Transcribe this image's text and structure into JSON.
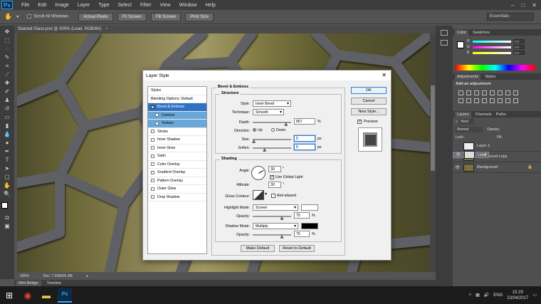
{
  "app": {
    "logo": "Ps"
  },
  "menu": [
    "File",
    "Edit",
    "Image",
    "Layer",
    "Type",
    "Select",
    "Filter",
    "View",
    "Window",
    "Help"
  ],
  "window_controls": [
    "–",
    "□",
    "✕"
  ],
  "options_bar": {
    "scroll_all": "Scroll All Windows",
    "buttons": [
      "Actual Pixels",
      "Fit Screen",
      "Fill Screen",
      "Print Size"
    ],
    "workspace": "Essentials"
  },
  "document": {
    "tab_title": "Stained Glass.psd @ 300% (Lead, RGB/8#)",
    "close": "×"
  },
  "status": {
    "zoom": "300%",
    "doc_info": "Doc: 7.03M/26.3M",
    "arrow": "▸"
  },
  "bottom_tabs": [
    "Mini Bridge",
    "Timeline"
  ],
  "color_panel": {
    "tabs": [
      "Color",
      "Swatches"
    ],
    "channels": [
      {
        "label": "R",
        "value": "255"
      },
      {
        "label": "G",
        "value": "255"
      },
      {
        "label": "B",
        "value": "255"
      }
    ]
  },
  "adjustments_panel": {
    "tabs": [
      "Adjustments",
      "Styles"
    ],
    "heading": "Add an adjustment"
  },
  "layers_panel": {
    "tabs": [
      "Layers",
      "Channels",
      "Paths"
    ],
    "kind": "Kind",
    "blend": "Normal",
    "opacity_label": "Opacity:",
    "fill_label": "Fill:",
    "lock_label": "Lock:",
    "layers": [
      {
        "name": "Layer 1",
        "visible": false,
        "selected": false
      },
      {
        "name": "Lead",
        "visible": true,
        "selected": true
      },
      {
        "name": "Background copy",
        "visible": true,
        "selected": false
      },
      {
        "name": "Background",
        "visible": true,
        "selected": false
      }
    ]
  },
  "taskbar": {
    "lang": "ENG",
    "time": "15:29",
    "date": "23/04/2017"
  },
  "dialog": {
    "title": "Layer Style",
    "close": "✕",
    "styles_list": [
      {
        "label": "Styles",
        "type": "header"
      },
      {
        "label": "Blending Options: Default",
        "type": "item"
      },
      {
        "label": "Bevel & Emboss",
        "type": "check",
        "checked": true,
        "state": "selected"
      },
      {
        "label": "Contour",
        "type": "sub",
        "checked": false,
        "state": "blue"
      },
      {
        "label": "Texture",
        "type": "sub",
        "checked": false,
        "state": "blue"
      },
      {
        "label": "Stroke",
        "type": "check",
        "checked": false
      },
      {
        "label": "Inner Shadow",
        "type": "check",
        "checked": false
      },
      {
        "label": "Inner Glow",
        "type": "check",
        "checked": false
      },
      {
        "label": "Satin",
        "type": "check",
        "checked": false
      },
      {
        "label": "Color Overlay",
        "type": "check",
        "checked": false
      },
      {
        "label": "Gradient Overlay",
        "type": "check",
        "checked": false
      },
      {
        "label": "Pattern Overlay",
        "type": "check",
        "checked": false
      },
      {
        "label": "Outer Glow",
        "type": "check",
        "checked": false
      },
      {
        "label": "Drop Shadow",
        "type": "check",
        "checked": false
      }
    ],
    "section_title": "Bevel & Emboss",
    "structure": {
      "title": "Structure",
      "style_label": "Style:",
      "style_value": "Inner Bevel",
      "technique_label": "Technique:",
      "technique_value": "Smooth",
      "depth_label": "Depth:",
      "depth_value": "857",
      "depth_unit": "%",
      "depth_level": 0.857,
      "direction_label": "Direction:",
      "direction_up": "Up",
      "direction_down": "Down",
      "direction": "Up",
      "size_label": "Size:",
      "size_value": "5",
      "size_unit": "px",
      "size_level": 0.02,
      "soften_label": "Soften:",
      "soften_value": "5",
      "soften_unit": "px",
      "soften_level": 0.3
    },
    "shading": {
      "title": "Shading",
      "angle_label": "Angle:",
      "angle_value": "30",
      "angle_unit": "°",
      "use_global_light": "Use Global Light",
      "use_global_light_checked": true,
      "altitude_label": "Altitude:",
      "altitude_value": "30",
      "altitude_unit": "°",
      "gloss_label": "Gloss Contour:",
      "anti_aliased": "Anti-aliased",
      "anti_aliased_checked": false,
      "highlight_label": "Highlight Mode:",
      "highlight_value": "Screen",
      "highlight_color": "#ffffff",
      "hl_opacity_label": "Opacity:",
      "hl_opacity_value": "75",
      "hl_opacity_unit": "%",
      "hl_opacity_level": 0.75,
      "shadow_label": "Shadow Mode:",
      "shadow_value": "Multiply",
      "shadow_color": "#000000",
      "sh_opacity_label": "Opacity:",
      "sh_opacity_value": "75",
      "sh_opacity_unit": "%",
      "sh_opacity_level": 0.75
    },
    "make_default": "Make Default",
    "reset_default": "Reset to Default",
    "ok": "OK",
    "cancel": "Cancel",
    "new_style": "New Style...",
    "preview": "Preview",
    "preview_checked": true
  }
}
